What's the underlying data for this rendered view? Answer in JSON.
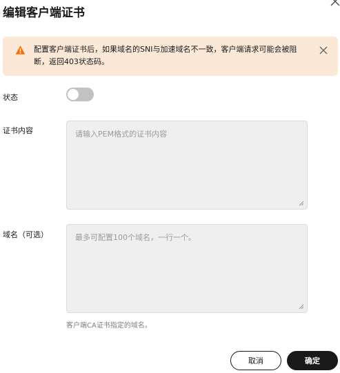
{
  "dialog": {
    "title": "编辑客户端证书",
    "close_icon": "close-icon"
  },
  "alert": {
    "icon": "warning-icon",
    "text": "配置客户端证书后，如果域名的SNI与加速域名不一致，客户端请求可能会被阻断，返回403状态码。",
    "close_icon": "close-icon"
  },
  "form": {
    "status": {
      "label": "状态",
      "enabled": false
    },
    "cert_content": {
      "label": "证书内容",
      "value": "",
      "placeholder": "请输入PEM格式的证书内容"
    },
    "domains": {
      "label": "域名（可选）",
      "value": "",
      "placeholder": "最多可配置100个域名，一行一个。",
      "help": "客户端CA证书指定的域名。"
    }
  },
  "buttons": {
    "cancel": "取消",
    "ok": "确定"
  },
  "colors": {
    "alert_bg": "#fce8d7",
    "warning": "#f66f03",
    "primary": "#191919",
    "toggle_off": "#c2c2c2"
  }
}
